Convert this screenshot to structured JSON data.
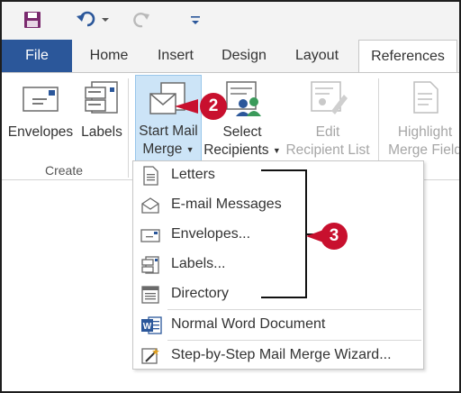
{
  "colors": {
    "file_tab": "#2b579a",
    "chrome_bg": "#f3f3f3",
    "selected_button": "#cce4f7",
    "callout": "#c8102e",
    "word_blue": "#2b579a"
  },
  "qat": {
    "save_icon": "save-icon",
    "undo_icon": "undo-icon",
    "redo_icon": "redo-icon",
    "customize_icon": "customize-qat-icon"
  },
  "tabs": {
    "file": "File",
    "home": "Home",
    "insert": "Insert",
    "design": "Design",
    "layout": "Layout",
    "references": "References"
  },
  "ribbon": {
    "envelopes": "Envelopes",
    "labels": "Labels",
    "create_group": "Create",
    "start_mail_line1": "Start Mail",
    "start_mail_line2": "Merge",
    "select_line1": "Select",
    "select_line2": "Recipients",
    "edit_line1": "Edit",
    "edit_line2": "Recipient List",
    "highlight_line1": "Highlight",
    "highlight_line2": "Merge Field"
  },
  "menu": {
    "items": [
      {
        "label": "Letters",
        "icon": "letter-document-icon"
      },
      {
        "label": "E-mail Messages",
        "icon": "email-envelope-icon"
      },
      {
        "label": "Envelopes...",
        "icon": "envelope-icon"
      },
      {
        "label": "Labels...",
        "icon": "labels-icon"
      },
      {
        "label": "Directory",
        "icon": "directory-icon"
      },
      {
        "label": "Normal Word Document",
        "icon": "word-document-icon"
      },
      {
        "label": "Step-by-Step Mail Merge Wizard...",
        "icon": "wizard-icon"
      }
    ]
  },
  "callouts": {
    "two": "2",
    "three": "3"
  }
}
